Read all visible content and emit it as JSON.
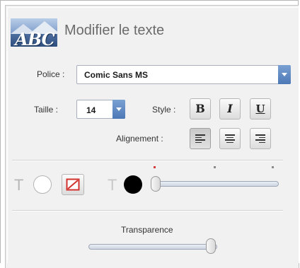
{
  "header": {
    "logo_text": "ABC",
    "title": "Modifier le texte"
  },
  "font": {
    "label": "Police :",
    "value": "Comic Sans MS"
  },
  "size": {
    "label": "Taille :",
    "value": "14"
  },
  "style": {
    "label": "Style :",
    "bold": "B",
    "italic": "I",
    "underline": "U"
  },
  "alignment": {
    "label": "Alignement :",
    "selected": "left"
  },
  "colors": {
    "background_color": "#ffffff",
    "text_color": "#000000",
    "no_color_accent": "#d2322d",
    "tick_first_color": "#d23c3c",
    "accent": "#4c78b5"
  },
  "text_color_slider": {
    "level": 0
  },
  "transparency": {
    "label": "Transparence",
    "level": 1
  }
}
